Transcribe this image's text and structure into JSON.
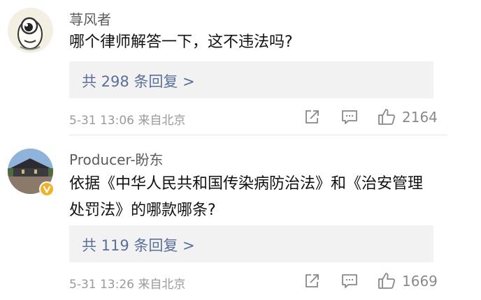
{
  "comments": [
    {
      "username": "荨风者",
      "text": "哪个律师解答一下，这不违法吗?",
      "replies": "共 298 条回复 >",
      "timestamp": "5-31 13:06",
      "source": "来自北京",
      "likes": "2164",
      "avatar_icon": "cartoon-face-icon"
    },
    {
      "username": "Producer-盼东",
      "text": "依据《中华人民共和国传染病防治法》和《治安管理处罚法》的哪款哪条?",
      "replies": "共 119 条回复 >",
      "timestamp": "5-31 13:26",
      "source": "来自北京",
      "likes": "1669",
      "avatar_icon": "landscape-photo-icon",
      "verified_badge": "V"
    }
  ],
  "colors": {
    "link": "#5b6f9b",
    "meta": "#9a9a9a",
    "reply_bg": "#f2f2f2",
    "verified": "#f0b22c"
  }
}
